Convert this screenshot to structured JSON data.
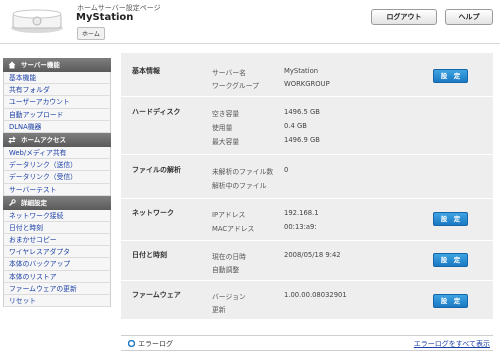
{
  "header": {
    "subtitle": "ホームサーバー設定ページ",
    "title": "MyStation",
    "breadcrumb": "ホーム",
    "logout_label": "ログアウト",
    "help_label": "ヘルプ"
  },
  "sidebar": {
    "sections": [
      {
        "title": "サーバー機能",
        "icon": "home-icon",
        "items": [
          "基本機能",
          "共有フォルダ",
          "ユーザーアカウント",
          "自動アップロード",
          "DLNA機器"
        ]
      },
      {
        "title": "ホームアクセス",
        "icon": "network-icon",
        "items": [
          "Web/メディア共有",
          "データリンク（送信）",
          "データリンク（受信）",
          "サーバーテスト"
        ]
      },
      {
        "title": "詳細設定",
        "icon": "settings-icon",
        "items": [
          "ネットワーク接続",
          "日付と時刻",
          "おまかせコピー",
          "ワイヤレスアダプタ",
          "本体のバックアップ",
          "本体のリストア",
          "ファームウェアの更新",
          "リセット"
        ]
      }
    ]
  },
  "main": {
    "config_label": "設　定",
    "sections": [
      {
        "label": "基本情報",
        "keys": [
          "サーバー名",
          "ワークグループ"
        ],
        "values": [
          "MyStation",
          "WORKGROUP"
        ]
      },
      {
        "label": "ハードディスク",
        "keys": [
          "空き容量",
          "使用量",
          "最大容量"
        ],
        "values": [
          "1496.5 GB",
          "0.4 GB",
          "1496.9 GB"
        ]
      },
      {
        "label": "ファイルの解析",
        "keys": [
          "未解析のファイル数",
          "解析中のファイル"
        ],
        "values": [
          "0",
          ""
        ]
      },
      {
        "label": "ネットワーク",
        "keys": [
          "IPアドレス",
          "MACアドレス"
        ],
        "values": [
          "192.168.1",
          "00:13:a9:"
        ]
      },
      {
        "label": "日付と時刻",
        "keys": [
          "現在の日時",
          "自動調整"
        ],
        "values": [
          "2008/05/18 9:42",
          ""
        ]
      },
      {
        "label": "ファームウェア",
        "keys": [
          "バージョン",
          "更新"
        ],
        "values": [
          "1.00.00.08032901",
          ""
        ]
      }
    ]
  },
  "errorlog": {
    "label": "エラーログ",
    "show_all": "エラーログをすべて表示"
  },
  "colors": {
    "accent_blue": "#1b78c2",
    "link_blue": "#1a3fa6",
    "sidebar_header": "#666666",
    "panel_bg": "#eeeeee"
  }
}
